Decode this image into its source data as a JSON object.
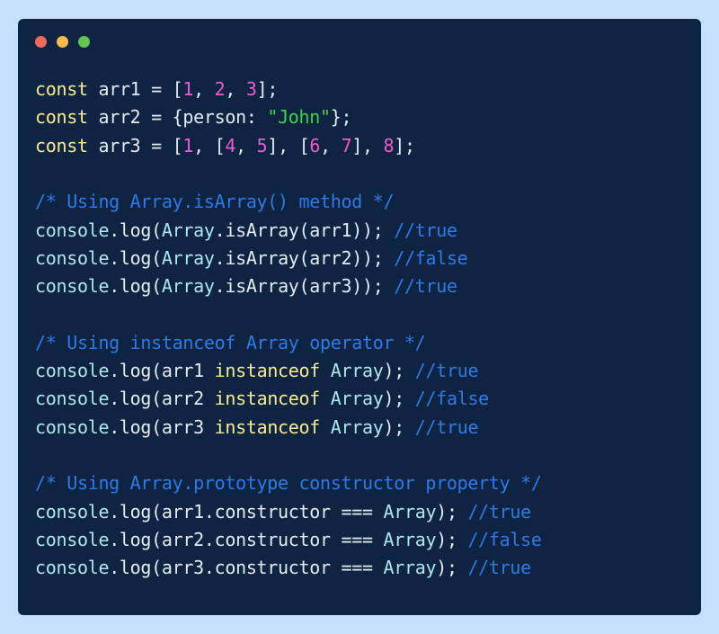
{
  "colors": {
    "background": "#c6e0fc",
    "window": "#0f2342",
    "dot_red": "#ee6a5f",
    "dot_yellow": "#f5bd4f",
    "dot_green": "#61c454",
    "keyword": "#f6ec8e",
    "identifier": "#aee6ee",
    "text": "#e3ebf5",
    "number": "#ea5fc9",
    "string": "#3fd24a",
    "comment": "#2d7be4"
  },
  "window_controls": [
    "close-dot",
    "minimize-dot",
    "maximize-dot"
  ],
  "code_lines": [
    [
      [
        "const",
        "keyword"
      ],
      [
        " arr1 = [",
        "text"
      ],
      [
        "1",
        "number"
      ],
      [
        ", ",
        "text"
      ],
      [
        "2",
        "number"
      ],
      [
        ", ",
        "text"
      ],
      [
        "3",
        "number"
      ],
      [
        "];",
        "text"
      ]
    ],
    [
      [
        "const",
        "keyword"
      ],
      [
        " arr2 = {person: ",
        "text"
      ],
      [
        "\"John\"",
        "string"
      ],
      [
        "};",
        "text"
      ]
    ],
    [
      [
        "const",
        "keyword"
      ],
      [
        " arr3 = [",
        "text"
      ],
      [
        "1",
        "number"
      ],
      [
        ", [",
        "text"
      ],
      [
        "4",
        "number"
      ],
      [
        ", ",
        "text"
      ],
      [
        "5",
        "number"
      ],
      [
        "], [",
        "text"
      ],
      [
        "6",
        "number"
      ],
      [
        ", ",
        "text"
      ],
      [
        "7",
        "number"
      ],
      [
        "], ",
        "text"
      ],
      [
        "8",
        "number"
      ],
      [
        "];",
        "text"
      ]
    ],
    [],
    [
      [
        "/* Using Array.isArray() method */",
        "comment"
      ]
    ],
    [
      [
        "console",
        "identifier"
      ],
      [
        ".log(",
        "text"
      ],
      [
        "Array",
        "identifier"
      ],
      [
        ".isArray(arr1)); ",
        "text"
      ],
      [
        "//true",
        "comment"
      ]
    ],
    [
      [
        "console",
        "identifier"
      ],
      [
        ".log(",
        "text"
      ],
      [
        "Array",
        "identifier"
      ],
      [
        ".isArray(arr2)); ",
        "text"
      ],
      [
        "//false",
        "comment"
      ]
    ],
    [
      [
        "console",
        "identifier"
      ],
      [
        ".log(",
        "text"
      ],
      [
        "Array",
        "identifier"
      ],
      [
        ".isArray(arr3)); ",
        "text"
      ],
      [
        "//true",
        "comment"
      ]
    ],
    [],
    [
      [
        "/* Using instanceof Array operator */",
        "comment"
      ]
    ],
    [
      [
        "console",
        "identifier"
      ],
      [
        ".log(arr1 ",
        "text"
      ],
      [
        "instanceof",
        "keyword"
      ],
      [
        " ",
        "text"
      ],
      [
        "Array",
        "identifier"
      ],
      [
        "); ",
        "text"
      ],
      [
        "//true",
        "comment"
      ]
    ],
    [
      [
        "console",
        "identifier"
      ],
      [
        ".log(arr2 ",
        "text"
      ],
      [
        "instanceof",
        "keyword"
      ],
      [
        " ",
        "text"
      ],
      [
        "Array",
        "identifier"
      ],
      [
        "); ",
        "text"
      ],
      [
        "//false",
        "comment"
      ]
    ],
    [
      [
        "console",
        "identifier"
      ],
      [
        ".log(arr3 ",
        "text"
      ],
      [
        "instanceof",
        "keyword"
      ],
      [
        " ",
        "text"
      ],
      [
        "Array",
        "identifier"
      ],
      [
        "); ",
        "text"
      ],
      [
        "//true",
        "comment"
      ]
    ],
    [],
    [
      [
        "/* Using Array.prototype constructor property */",
        "comment"
      ]
    ],
    [
      [
        "console",
        "identifier"
      ],
      [
        ".log(arr1.constructor ",
        "text"
      ],
      [
        "===",
        "text"
      ],
      [
        " ",
        "text"
      ],
      [
        "Array",
        "identifier"
      ],
      [
        "); ",
        "text"
      ],
      [
        "//true",
        "comment"
      ]
    ],
    [
      [
        "console",
        "identifier"
      ],
      [
        ".log(arr2.constructor ",
        "text"
      ],
      [
        "===",
        "text"
      ],
      [
        " ",
        "text"
      ],
      [
        "Array",
        "identifier"
      ],
      [
        "); ",
        "text"
      ],
      [
        "//false",
        "comment"
      ]
    ],
    [
      [
        "console",
        "identifier"
      ],
      [
        ".log(arr3.constructor ",
        "text"
      ],
      [
        "===",
        "text"
      ],
      [
        " ",
        "text"
      ],
      [
        "Array",
        "identifier"
      ],
      [
        "); ",
        "text"
      ],
      [
        "//true",
        "comment"
      ]
    ]
  ]
}
